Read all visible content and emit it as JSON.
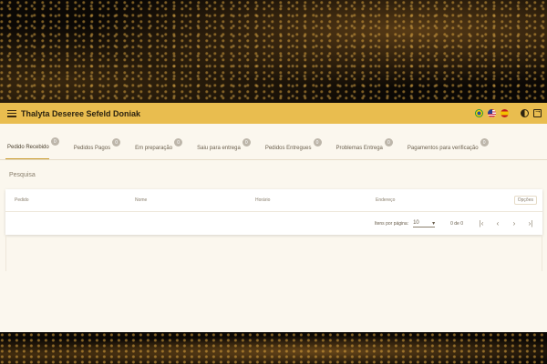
{
  "header": {
    "title": "Thalyta Deseree Sefeld Doniak"
  },
  "tabs": [
    {
      "label": "Pedido Recebido",
      "count": "0"
    },
    {
      "label": "Pedidos Pagos",
      "count": "0"
    },
    {
      "label": "Em preparação",
      "count": "0"
    },
    {
      "label": "Saiu para entrega",
      "count": "0"
    },
    {
      "label": "Pedidos Entregues",
      "count": "0"
    },
    {
      "label": "Problemas Entrega",
      "count": "0"
    },
    {
      "label": "Pagamentos para verificação",
      "count": "0"
    }
  ],
  "search": {
    "label": "Pesquisa"
  },
  "table": {
    "columns": [
      "Pedido",
      "Nome",
      "Horário",
      "Endereço"
    ],
    "options_label": "Opções"
  },
  "paginator": {
    "items_per_page_label": "Itens por página:",
    "page_size": "10",
    "range": "0 de 0"
  },
  "colors": {
    "header": "#e9bd4f",
    "accent": "#c99a2a",
    "background": "#fbf7ee"
  }
}
